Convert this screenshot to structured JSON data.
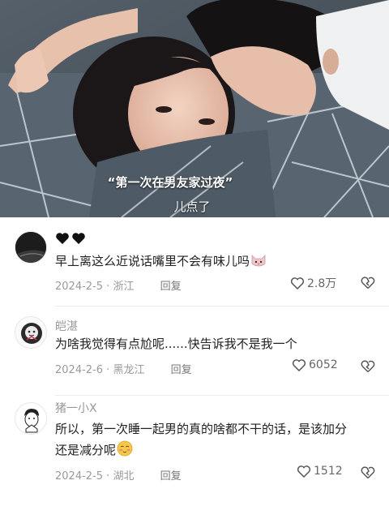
{
  "video": {
    "subtitle_1": "“第一次在男友家过夜”",
    "subtitle_2": "儿点了"
  },
  "comments": [
    {
      "username": "",
      "username_icon": "two-black-hearts-icon",
      "text": "早上离这么近说话嘴里不会有味儿吗",
      "emoji": "cat-face-icon",
      "date": "2024-2-5",
      "location": "浙江",
      "reply_label": "回复",
      "likes": "2.8万"
    },
    {
      "username": "皑湛",
      "text": "为啥我觉得有点尬呢......快告诉我不是我一个",
      "date": "2024-2-6",
      "location": "黑龙江",
      "reply_label": "回复",
      "likes": "6052"
    },
    {
      "username": "猪一小X",
      "text_line1": "所以，第一次睡一起男的真的啥都不干的话，是该加分",
      "text_line2": "还是减分呢",
      "emoji": "blushing-face-icon",
      "date": "2024-2-5",
      "location": "湖北",
      "reply_label": "回复",
      "likes": "1512"
    }
  ],
  "colors": {
    "text": "#222222",
    "meta": "#9a9a9a",
    "divider": "#ededed"
  }
}
